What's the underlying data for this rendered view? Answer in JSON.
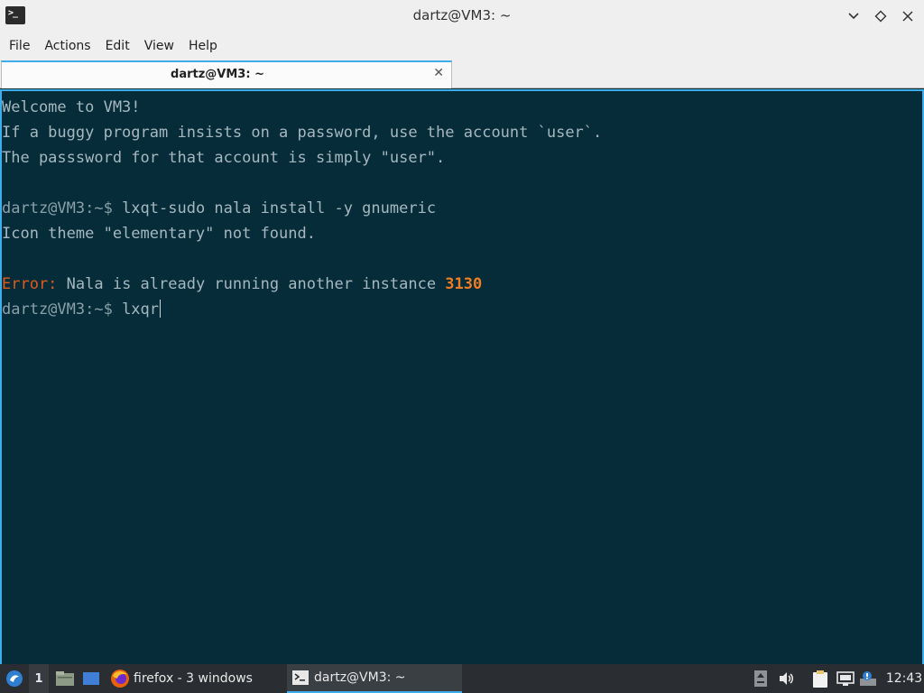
{
  "window": {
    "title": "dartz@VM3: ~",
    "icon": "terminal-icon",
    "controls": {
      "minimize": "chevron-down-icon",
      "maximize": "diamond-icon",
      "close": "close-icon"
    }
  },
  "menubar": {
    "items": [
      {
        "label": "File"
      },
      {
        "label": "Actions"
      },
      {
        "label": "Edit"
      },
      {
        "label": "View"
      },
      {
        "label": "Help"
      }
    ]
  },
  "tabs": [
    {
      "label": "dartz@VM3: ~",
      "active": true,
      "close_icon": "close-icon"
    }
  ],
  "terminal": {
    "background": "#062c3a",
    "lines": [
      {
        "text": "Welcome to VM3!"
      },
      {
        "text": "If a buggy program insists on a password, use the account `user`."
      },
      {
        "text": "The passsword for that account is simply \"user\"."
      },
      {
        "text": ""
      },
      {
        "prompt": "dartz@VM3:~$ ",
        "command": "lxqt-sudo nala install -y gnumeric"
      },
      {
        "text": "Icon theme \"elementary\" not found."
      },
      {
        "text": ""
      },
      {
        "error_label": "Error:",
        "text": " Nala is already running another instance ",
        "error_value": "3130"
      },
      {
        "prompt": "dartz@VM3:~$ ",
        "command": "lxqr"
      }
    ]
  },
  "taskbar": {
    "start_icon": "start-menu-icon",
    "desktop_number": "1",
    "launchers": [
      "file-manager-icon",
      "show-desktop-icon"
    ],
    "tasks": [
      {
        "label": "firefox - 3 windows",
        "icon": "firefox-icon",
        "active": false
      },
      {
        "label": "dartz@VM3: ~",
        "icon": "terminal-icon",
        "active": true
      }
    ],
    "tray": [
      "upload-icon",
      "volume-icon",
      "clipboard-icon",
      "network-icon",
      "update-notifier-icon"
    ],
    "clock": "12:43",
    "accent": "#3daee9"
  }
}
